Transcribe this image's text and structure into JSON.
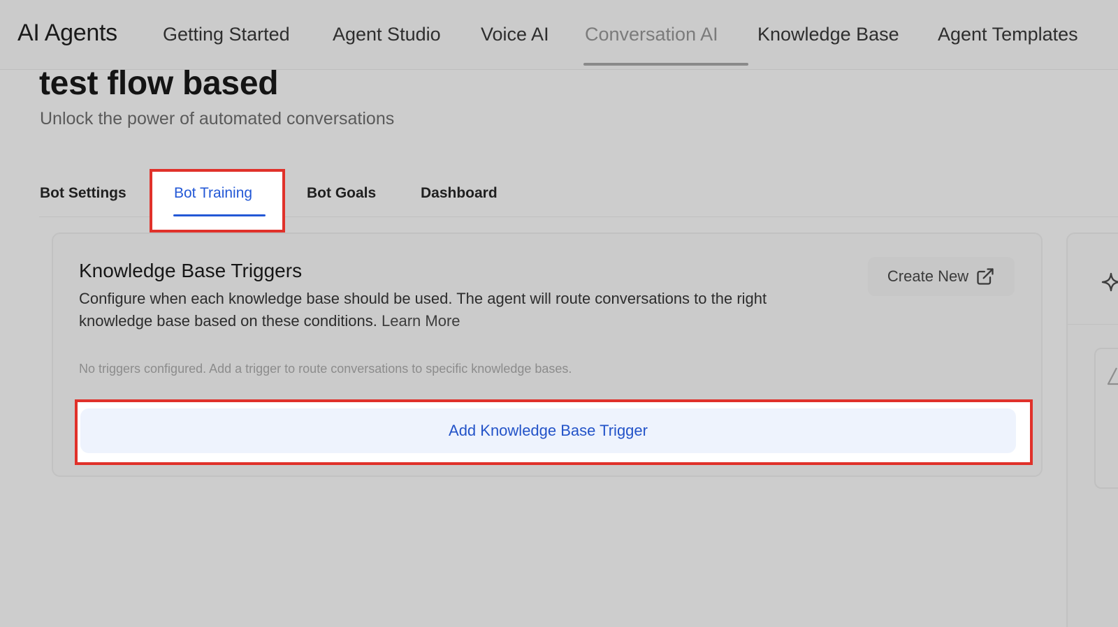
{
  "app": {
    "brand": "AI Agents",
    "nav": [
      {
        "label": "Getting Started",
        "active": false
      },
      {
        "label": "Agent Studio",
        "active": false
      },
      {
        "label": "Voice AI",
        "active": false
      },
      {
        "label": "Conversation AI",
        "active": true
      },
      {
        "label": "Knowledge Base",
        "active": false
      },
      {
        "label": "Agent Templates",
        "active": false
      }
    ]
  },
  "header": {
    "title": "test flow based",
    "subtitle": "Unlock the power of automated conversations"
  },
  "tabs": [
    {
      "label": "Bot Settings",
      "active": false
    },
    {
      "label": "Bot Training",
      "active": true
    },
    {
      "label": "Bot Goals",
      "active": false
    },
    {
      "label": "Dashboard",
      "active": false
    }
  ],
  "kb_triggers": {
    "title": "Knowledge Base Triggers",
    "description": "Configure when each knowledge base should be used. The agent will route conversations to the right knowledge base based on these conditions.",
    "learn_more": "Learn More",
    "create_new": "Create New",
    "empty_note": "No triggers configured. Add a trigger to route conversations to specific knowledge bases.",
    "add_button": "Add Knowledge Base Trigger"
  },
  "icons": {
    "create_new": "external-link-icon",
    "side_panel": "sparkle-icon",
    "side_inner": "warning-icon"
  },
  "colors": {
    "accent": "#2358d6",
    "highlight": "#e0312a",
    "add_button_bg": "#eef3fd"
  }
}
